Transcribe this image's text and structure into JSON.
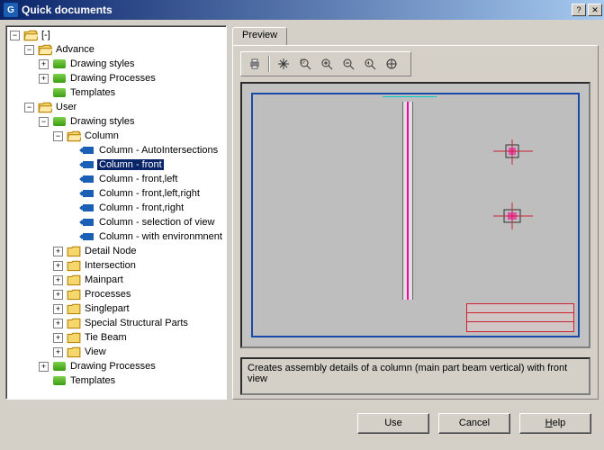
{
  "window": {
    "title": "Quick documents"
  },
  "tree": {
    "root": "[-]",
    "advance": {
      "label": "Advance",
      "drawing_styles": "Drawing styles",
      "drawing_processes": "Drawing Processes",
      "templates": "Templates"
    },
    "user": {
      "label": "User",
      "drawing_styles": "Drawing styles",
      "drawing_processes": "Drawing Processes",
      "templates": "Templates",
      "column": {
        "label": "Column",
        "items": [
          "Column - AutoIntersections",
          "Column - front",
          "Column - front,left",
          "Column - front,left,right",
          "Column - front,right",
          "Column - selection of view",
          "Column - with environmnent"
        ]
      },
      "folders": {
        "detail_node": "Detail Node",
        "intersection": "Intersection",
        "mainpart": "Mainpart",
        "processes": "Processes",
        "singlepart": "Singlepart",
        "special": "Special Structural Parts",
        "tie_beam": "Tie Beam",
        "view": "View"
      }
    }
  },
  "selected_item": "Column - front",
  "preview": {
    "tab": "Preview",
    "description": "Creates assembly details of a column (main part beam vertical) with front view"
  },
  "toolbar": {
    "print": "print",
    "hand": "pan",
    "zoom_window": "zoom-window",
    "zoom_in": "zoom-in",
    "zoom_out": "zoom-out",
    "zoom_prev": "zoom-previous",
    "zoom_ext": "zoom-extents"
  },
  "buttons": {
    "use": "Use",
    "cancel": "Cancel",
    "help": "Help"
  }
}
